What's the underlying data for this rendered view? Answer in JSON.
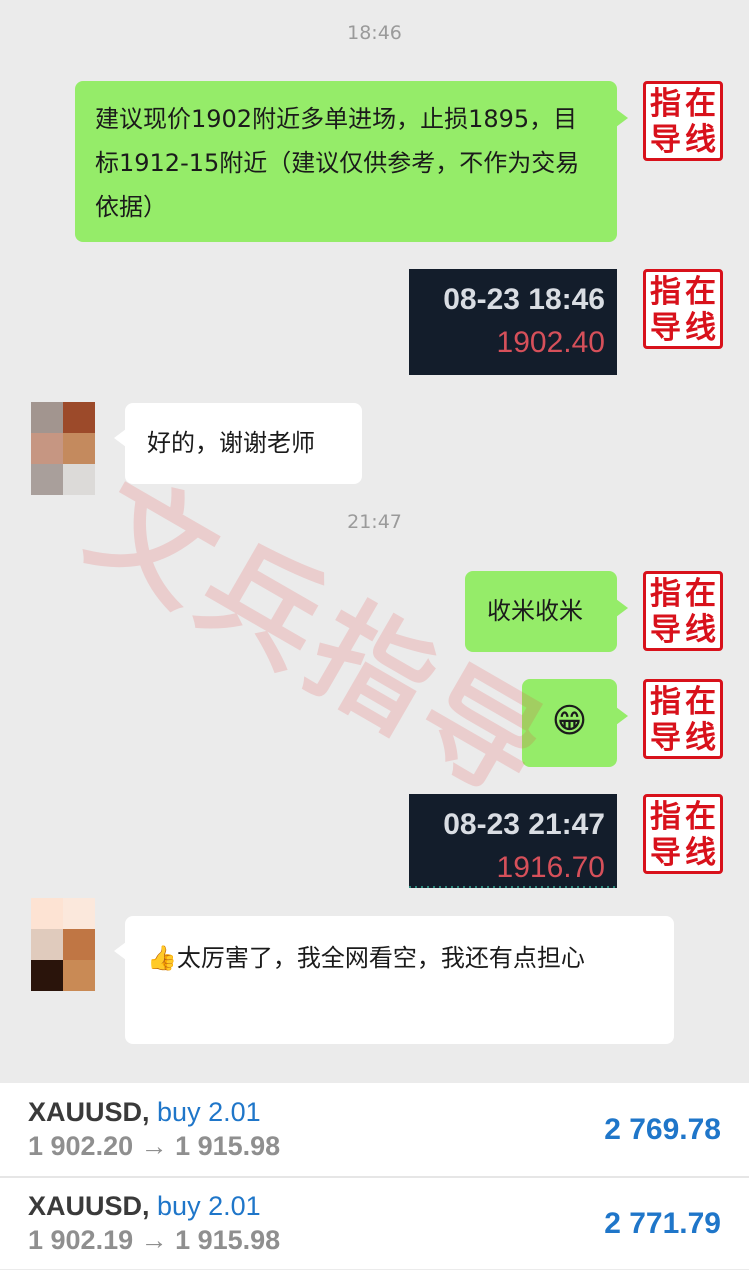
{
  "chat": {
    "time_1": "18:46",
    "time_2": "21:47",
    "msg_advice": "建议现价1902附近多单进场，止损1895，目标1912-15附近（建议仅供参考，不作为交易依据）",
    "price_card_1": {
      "time": "08-23 18:46",
      "price": "1902.40"
    },
    "msg_ok": "好的，谢谢老师",
    "msg_take_profit": "收米收米",
    "emoji_grin": "😁",
    "price_card_2": {
      "time": "08-23 21:47",
      "price": "1916.70"
    },
    "msg_praise_icon": "👍",
    "msg_praise": "太厉害了，我全网看空，我还有点担心"
  },
  "seal": {
    "c1": "指",
    "c2": "在",
    "c3": "导",
    "c4": "线"
  },
  "watermark": "文兵指导",
  "trades": [
    {
      "symbol": "XAUUSD,",
      "side": "buy 2.01",
      "range": "1 902.20 → 1 915.98",
      "profit": "2 769.78"
    },
    {
      "symbol": "XAUUSD,",
      "side": "buy 2.01",
      "range": "1 902.19 → 1 915.98",
      "profit": "2 771.79"
    }
  ],
  "colors": {
    "chat_bg": "#ebebeb",
    "bubble_green": "#95ec69",
    "seal_red": "#d8111b",
    "card_bg": "#131d2b",
    "card_price": "#d6505a",
    "trade_blue": "#1f76c9"
  }
}
